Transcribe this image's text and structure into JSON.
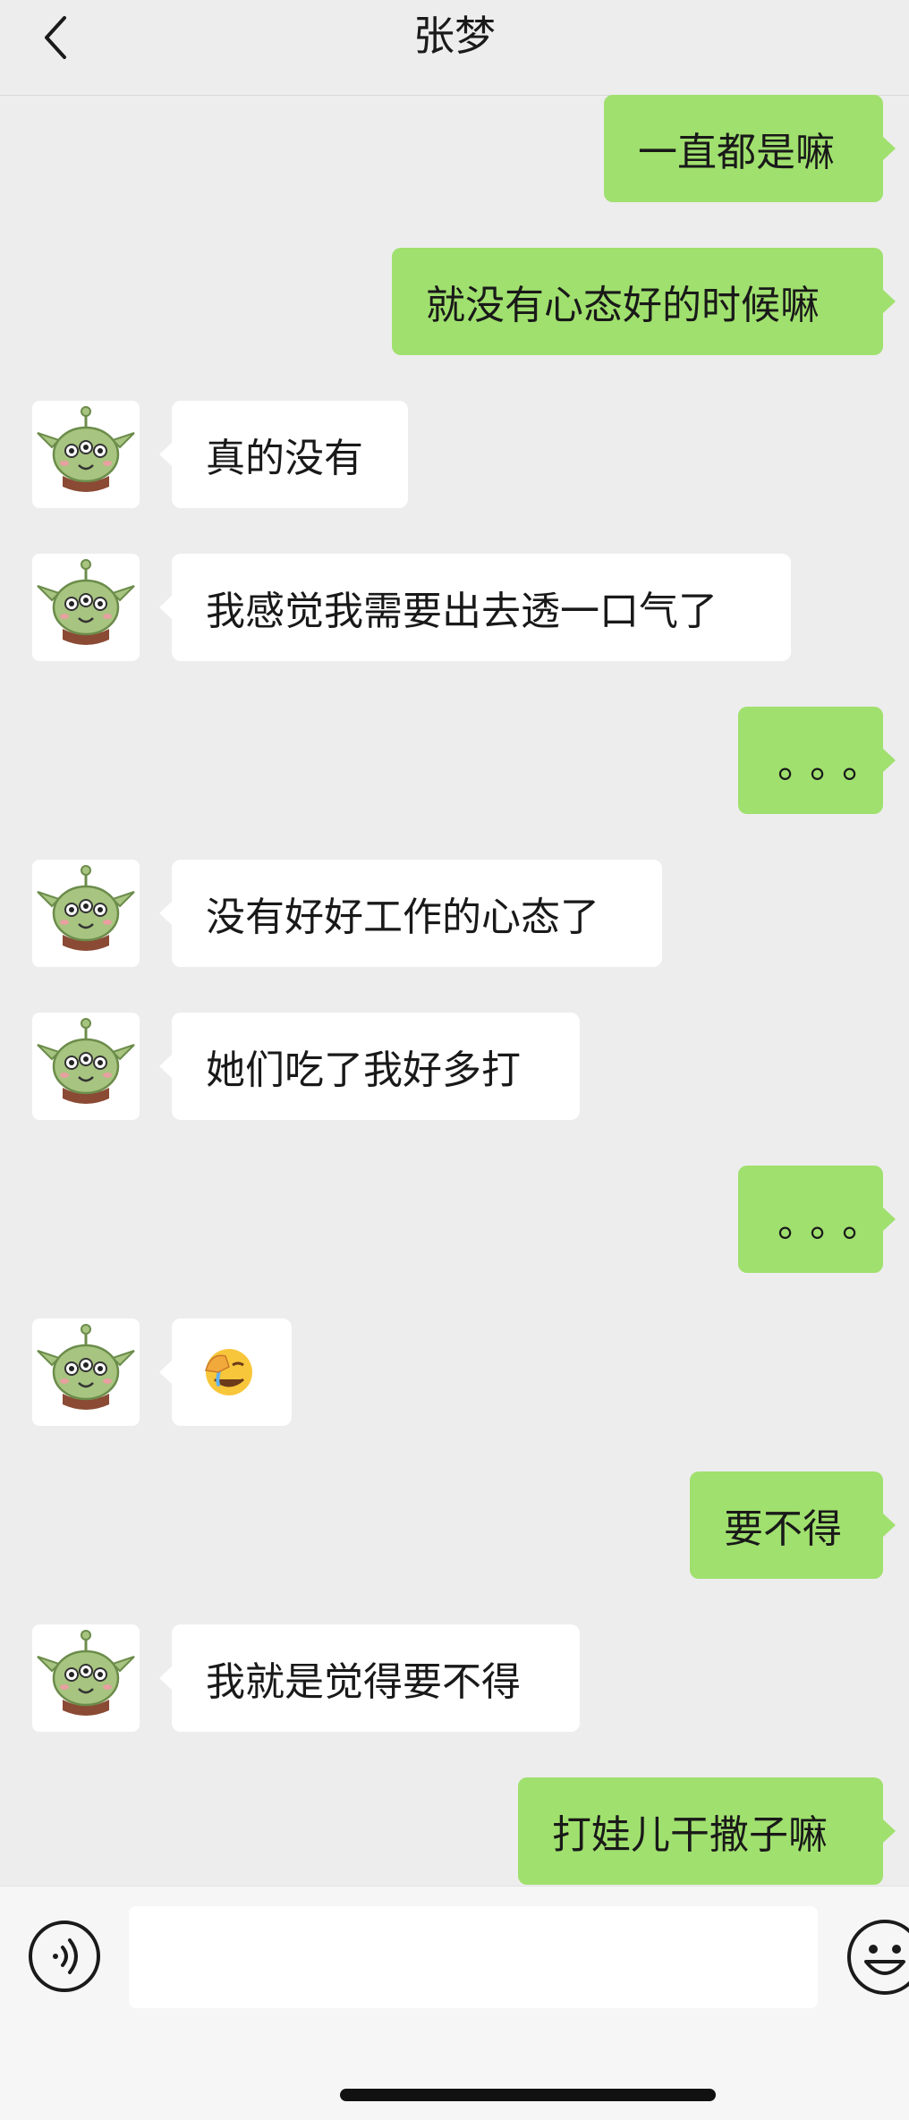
{
  "header": {
    "title": "张梦",
    "back_icon": "chevron-left-icon"
  },
  "messages": [
    {
      "side": "out",
      "text": "一直都是嘛"
    },
    {
      "side": "out",
      "text": "就没有心态好的时候嘛"
    },
    {
      "side": "in",
      "text": "真的没有"
    },
    {
      "side": "in",
      "text": "我感觉我需要出去透一口气了"
    },
    {
      "side": "out",
      "text": "。。。"
    },
    {
      "side": "in",
      "text": "没有好好工作的心态了"
    },
    {
      "side": "in",
      "text": "她们吃了我好多打"
    },
    {
      "side": "out",
      "text": "。。。"
    },
    {
      "side": "in",
      "text": "",
      "emoji": "face-palm-crying-emoji"
    },
    {
      "side": "out",
      "text": "要不得"
    },
    {
      "side": "in",
      "text": "我就是觉得要不得"
    },
    {
      "side": "out",
      "text": "打娃儿干撒子嘛"
    }
  ],
  "input_bar": {
    "voice_icon": "voice-icon",
    "emoji_icon": "smiley-icon",
    "input_value": ""
  },
  "colors": {
    "background": "#ededed",
    "outgoing_bubble": "#a0e06e",
    "incoming_bubble": "#ffffff"
  }
}
